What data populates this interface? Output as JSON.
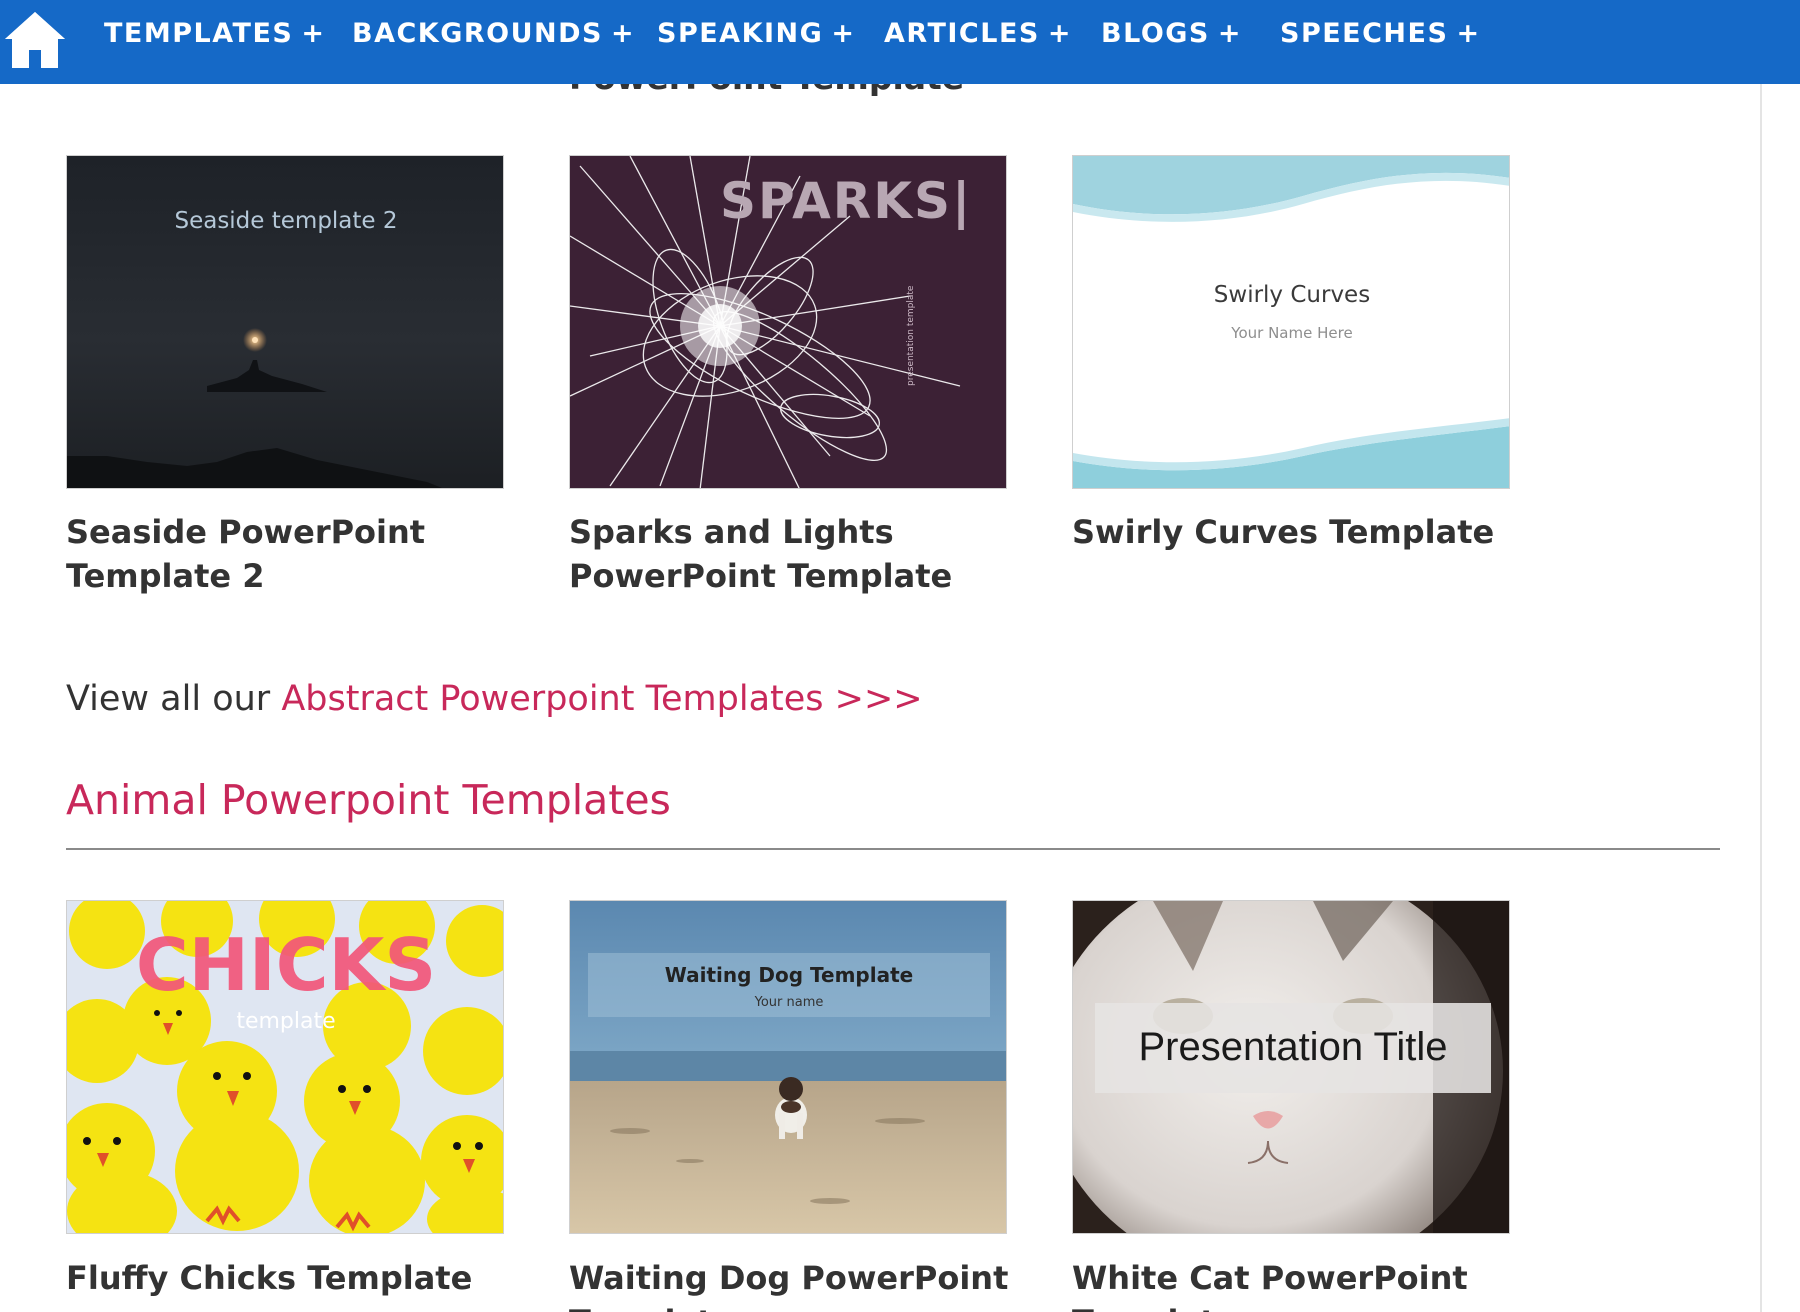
{
  "nav": {
    "home_icon": "home-icon",
    "items": [
      {
        "label": "TEMPLATES",
        "plus": "+"
      },
      {
        "label": "BACKGROUNDS",
        "plus": "+"
      },
      {
        "label": "SPEAKING",
        "plus": "+"
      },
      {
        "label": "ARTICLES",
        "plus": "+"
      },
      {
        "label": "BLOGS",
        "plus": "+"
      },
      {
        "label": "SPEECHES",
        "plus": "+"
      }
    ],
    "bg_color": "#1569c7"
  },
  "abstract": {
    "cutoff_title": "PowerPoint Template",
    "cards": [
      {
        "title": "Seaside PowerPoint Template 2",
        "thumb_text": "Seaside template 2"
      },
      {
        "title": "Sparks and Lights PowerPoint Template",
        "thumb_text": "SPARKS|",
        "thumb_side_text": "presentation template"
      },
      {
        "title": "Swirly Curves Template",
        "thumb_text": "Swirly Curves",
        "thumb_subtext": "Your Name Here"
      }
    ],
    "view_all_prefix": "View all our ",
    "view_all_link": "Abstract Powerpoint Templates >>>"
  },
  "animal": {
    "heading": "Animal Powerpoint Templates",
    "cards": [
      {
        "title": "Fluffy Chicks Template",
        "thumb_text": "CHICKS",
        "thumb_subtext": "template"
      },
      {
        "title": "Waiting Dog PowerPoint Template",
        "thumb_text": "Waiting Dog Template",
        "thumb_subtext": "Your name"
      },
      {
        "title": "White Cat PowerPoint Template",
        "thumb_text": "Presentation Title"
      }
    ]
  },
  "colors": {
    "accent_link": "#c8285a",
    "text": "#333333"
  }
}
